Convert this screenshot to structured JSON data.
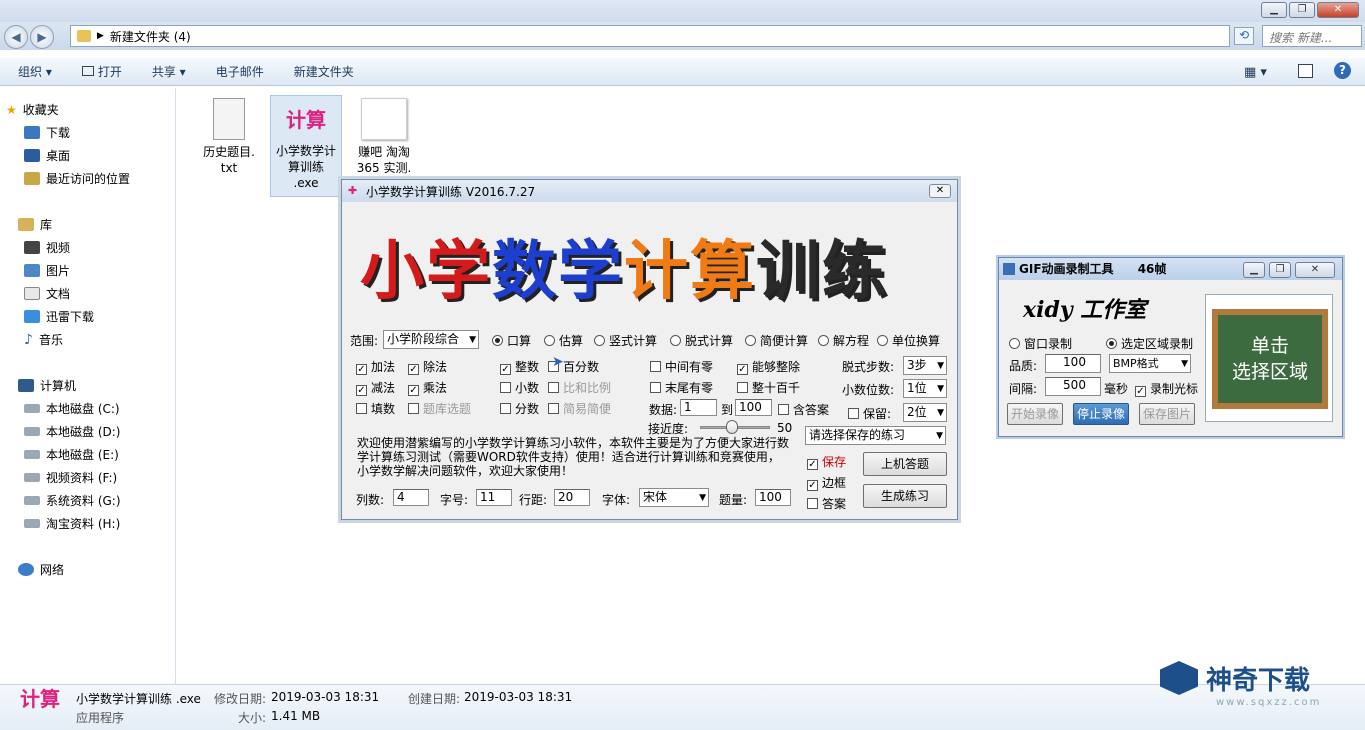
{
  "window": {
    "min": "▁",
    "max": "❐",
    "close": "✕"
  },
  "address": {
    "path": "新建文件夹 (4)",
    "search_placeholder": "搜索 新建..."
  },
  "toolbar": {
    "organize": "组织 ▾",
    "open": "打开",
    "share": "共享 ▾",
    "email": "电子邮件",
    "new_folder": "新建文件夹"
  },
  "sidebar": {
    "favorites": "收藏夹",
    "downloads": "下载",
    "desktop": "桌面",
    "recent": "最近访问的位置",
    "libraries": "库",
    "videos": "视频",
    "pictures": "图片",
    "documents": "文档",
    "xunlei": "迅雷下载",
    "music": "音乐",
    "computer": "计算机",
    "drives": [
      "本地磁盘 (C:)",
      "本地磁盘 (D:)",
      "本地磁盘 (E:)",
      "视频资料 (F:)",
      "系统资料 (G:)",
      "淘宝资料 (H:)"
    ],
    "network": "网络"
  },
  "files": [
    {
      "name": "历史题目.txt",
      "line1": "历史题目.",
      "line2": "txt"
    },
    {
      "name": "小学数学计算训练.exe",
      "line1": "小学数学计",
      "line2": "算训练",
      "line3": ".exe",
      "icon_text": "计算"
    },
    {
      "name": "赚吧 淘淘365 实测.",
      "line1": "赚吧 淘淘",
      "line2": "365 实测."
    }
  ],
  "details": {
    "filename": "小学数学计算训练 .exe",
    "type": "应用程序",
    "modified_label": "修改日期:",
    "modified": "2019-03-03 18:31",
    "created_label": "创建日期:",
    "created": "2019-03-03 18:31",
    "size_label": "大小:",
    "size": "1.41 MB"
  },
  "dialog": {
    "title": "小学数学计算训练 V2016.7.27",
    "big_title": [
      "小",
      "学",
      "数",
      "学",
      "计",
      "算",
      "训",
      "练"
    ],
    "range_label": "范围:",
    "range_value": "小学阶段综合",
    "modes": [
      "口算",
      "估算",
      "竖式计算",
      "脱式计算",
      "简便计算",
      "解方程",
      "单位换算"
    ],
    "ops": [
      "加法",
      "除法",
      "减法",
      "乘法",
      "填数",
      "题库选题"
    ],
    "types": [
      "整数",
      "百分数",
      "小数",
      "比和比例",
      "分数",
      "简易简便"
    ],
    "opts": [
      "中间有零",
      "能够整除",
      "末尾有零",
      "整十百千"
    ],
    "steps_label": "脱式步数:",
    "steps_value": "3步",
    "decimals_label": "小数位数:",
    "decimals_value": "1位",
    "keep_label": "保留:",
    "keep_value": "2位",
    "data_label": "数据:",
    "data_from": "1",
    "data_to_label": "到",
    "data_to": "100",
    "include_answer": "含答案",
    "proximity_label": "接近度:",
    "proximity_value": "50",
    "saved_placeholder": "请选择保存的练习",
    "intro": "欢迎使用潜紫编写的小学数学计算练习小软件，本软件主要是为了方便大家进行数学计算练习测试（需要WORD软件支持）使用！适合进行计算训练和竞赛使用，小学数学解决问题软件，欢迎大家使用！",
    "save": "保存",
    "border": "边框",
    "answer": "答案",
    "btn_online": "上机答题",
    "btn_generate": "生成练习",
    "cols_label": "列数:",
    "cols": "4",
    "font_size_label": "字号:",
    "font_size": "11",
    "line_space_label": "行距:",
    "line_space": "20",
    "font_label": "字体:",
    "font": "宋体",
    "count_label": "题量:",
    "count": "100"
  },
  "gif": {
    "title": "GIF动画录制工具",
    "frames": "46帧",
    "brand": "xidy 工作室",
    "win_record": "窗口录制",
    "area_record": "选定区域录制",
    "quality_label": "品质:",
    "quality": "100",
    "format": "BMP格式",
    "interval_label": "间隔:",
    "interval": "500",
    "ms": "毫秒",
    "cursor": "录制光标",
    "btn_start": "开始录像",
    "btn_stop": "停止录像",
    "btn_save": "保存图片",
    "board_line1": "单击",
    "board_line2": "选择区域"
  },
  "watermark": {
    "text": "神奇下载",
    "url": "www.sqxzz.com"
  }
}
